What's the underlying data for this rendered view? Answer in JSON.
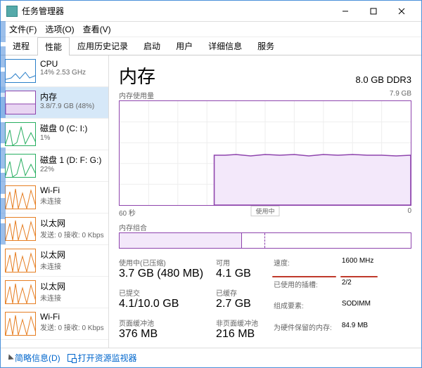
{
  "window": {
    "title": "任务管理器"
  },
  "menu": {
    "file": "文件(F)",
    "options": "选项(O)",
    "view": "查看(V)"
  },
  "tabs": [
    "进程",
    "性能",
    "应用历史记录",
    "启动",
    "用户",
    "详细信息",
    "服务"
  ],
  "tabs_selected_index": 1,
  "sidebar": {
    "selected_index": 1,
    "items": [
      {
        "name": "CPU",
        "sub": "14% 2.53 GHz",
        "kind": "cpu"
      },
      {
        "name": "内存",
        "sub": "3.8/7.9 GB (48%)",
        "kind": "mem"
      },
      {
        "name": "磁盘 0 (C: I:)",
        "sub": "1%",
        "kind": "disk"
      },
      {
        "name": "磁盘 1 (D: F: G:)",
        "sub": "22%",
        "kind": "disk"
      },
      {
        "name": "Wi-Fi",
        "sub": "未连接",
        "kind": "net"
      },
      {
        "name": "以太网",
        "sub": "发送: 0 接收: 0 Kbps",
        "kind": "net"
      },
      {
        "name": "以太网",
        "sub": "未连接",
        "kind": "net"
      },
      {
        "name": "以太网",
        "sub": "未连接",
        "kind": "net"
      },
      {
        "name": "Wi-Fi",
        "sub": "发送: 0 接收: 0 Kbps",
        "kind": "net"
      }
    ]
  },
  "main": {
    "title": "内存",
    "spec": "8.0 GB DDR3",
    "usage_label": "内存使用量",
    "usage_max": "7.9 GB",
    "time_left": "60 秒",
    "time_right": "0",
    "inuse_label": "使用中",
    "composition_label": "内存组合",
    "stats_left": [
      {
        "lbl": "使用中(已压缩)",
        "val": "3.7 GB (480 MB)"
      },
      {
        "lbl": "可用",
        "val": "4.1 GB"
      },
      {
        "lbl": "已提交",
        "val": "4.1/10.0 GB"
      },
      {
        "lbl": "已缓存",
        "val": "2.7 GB"
      },
      {
        "lbl": "页面缓冲池",
        "val": "376 MB"
      },
      {
        "lbl": "非页面缓冲池",
        "val": "216 MB"
      }
    ],
    "stats_right": [
      {
        "k": "速度:",
        "v": "1600 MHz",
        "hl": true
      },
      {
        "k": "已使用的插槽:",
        "v": "2/2"
      },
      {
        "k": "组成要素:",
        "v": "SODIMM"
      },
      {
        "k": "为硬件保留的内存:",
        "v": "84.9 MB"
      }
    ]
  },
  "footer": {
    "less": "简略信息(D)",
    "resmon": "打开资源监视器"
  },
  "chart_data": {
    "type": "area",
    "title": "内存使用量",
    "xlabel": "60 秒",
    "ylabel": "",
    "ylim": [
      0,
      7.9
    ],
    "y_unit": "GB",
    "x_seconds": [
      60,
      0
    ],
    "series": [
      {
        "name": "使用中",
        "values": [
          0,
          0,
          0,
          0,
          0,
          0,
          0,
          0,
          0,
          0,
          0,
          0,
          0,
          0,
          0,
          0,
          0,
          0,
          0,
          0,
          3.8,
          3.8,
          3.8,
          3.9,
          3.8,
          3.8,
          3.9,
          3.8,
          3.8,
          3.9,
          3.8,
          3.8,
          3.8,
          3.9,
          3.8,
          3.8,
          3.9,
          3.8,
          3.8,
          3.8,
          3.8,
          3.9,
          3.8,
          3.8,
          3.9,
          3.8,
          3.8,
          3.8,
          3.8,
          3.8,
          3.8,
          3.8,
          3.8,
          3.8,
          3.8,
          3.8,
          3.8,
          3.8,
          3.8,
          3.8,
          3.8
        ]
      }
    ]
  }
}
